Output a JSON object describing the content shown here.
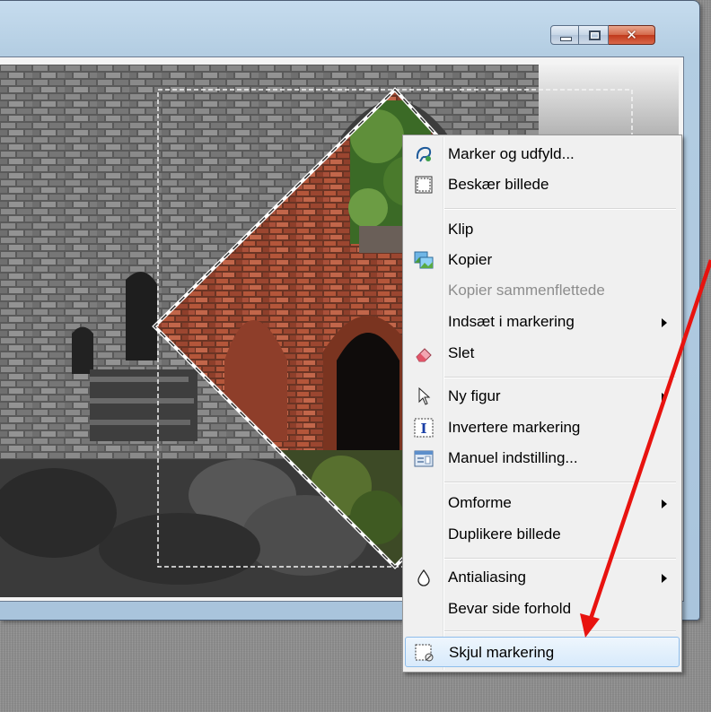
{
  "window": {
    "controls": {
      "minimize": "",
      "maximize": "",
      "close": "✕"
    }
  },
  "context_menu": {
    "items": [
      {
        "label": "Marker og udfyld...",
        "icon": "lasso-fill-icon",
        "enabled": true,
        "submenu": false
      },
      {
        "label": "Beskær billede",
        "icon": "crop-icon",
        "enabled": true,
        "submenu": false
      },
      {
        "label": "Klip",
        "icon": "",
        "enabled": true,
        "submenu": false
      },
      {
        "label": "Kopier",
        "icon": "copy-image-icon",
        "enabled": true,
        "submenu": false
      },
      {
        "label": "Kopier sammenflettede",
        "icon": "",
        "enabled": false,
        "submenu": false
      },
      {
        "label": "Indsæt i markering",
        "icon": "",
        "enabled": true,
        "submenu": true
      },
      {
        "label": "Slet",
        "icon": "eraser-icon",
        "enabled": true,
        "submenu": false
      },
      {
        "label": "Ny figur",
        "icon": "pointer-icon",
        "enabled": true,
        "submenu": true
      },
      {
        "label": "Invertere markering",
        "icon": "invert-selection-icon",
        "enabled": true,
        "submenu": false
      },
      {
        "label": "Manuel indstilling...",
        "icon": "manual-settings-icon",
        "enabled": true,
        "submenu": false
      },
      {
        "label": "Omforme",
        "icon": "",
        "enabled": true,
        "submenu": true
      },
      {
        "label": "Duplikere billede",
        "icon": "",
        "enabled": true,
        "submenu": false
      },
      {
        "label": "Antialiasing",
        "icon": "drop-icon",
        "enabled": true,
        "submenu": true
      },
      {
        "label": "Bevar side forhold",
        "icon": "",
        "enabled": true,
        "submenu": false
      },
      {
        "label": "Skjul markering",
        "icon": "hide-selection-icon",
        "enabled": true,
        "submenu": false,
        "highlighted": true
      }
    ]
  },
  "colors": {
    "annotation_arrow": "#e8130f",
    "menu_highlight_border": "#8ebdeb",
    "window_frame": "#b3cde2"
  }
}
